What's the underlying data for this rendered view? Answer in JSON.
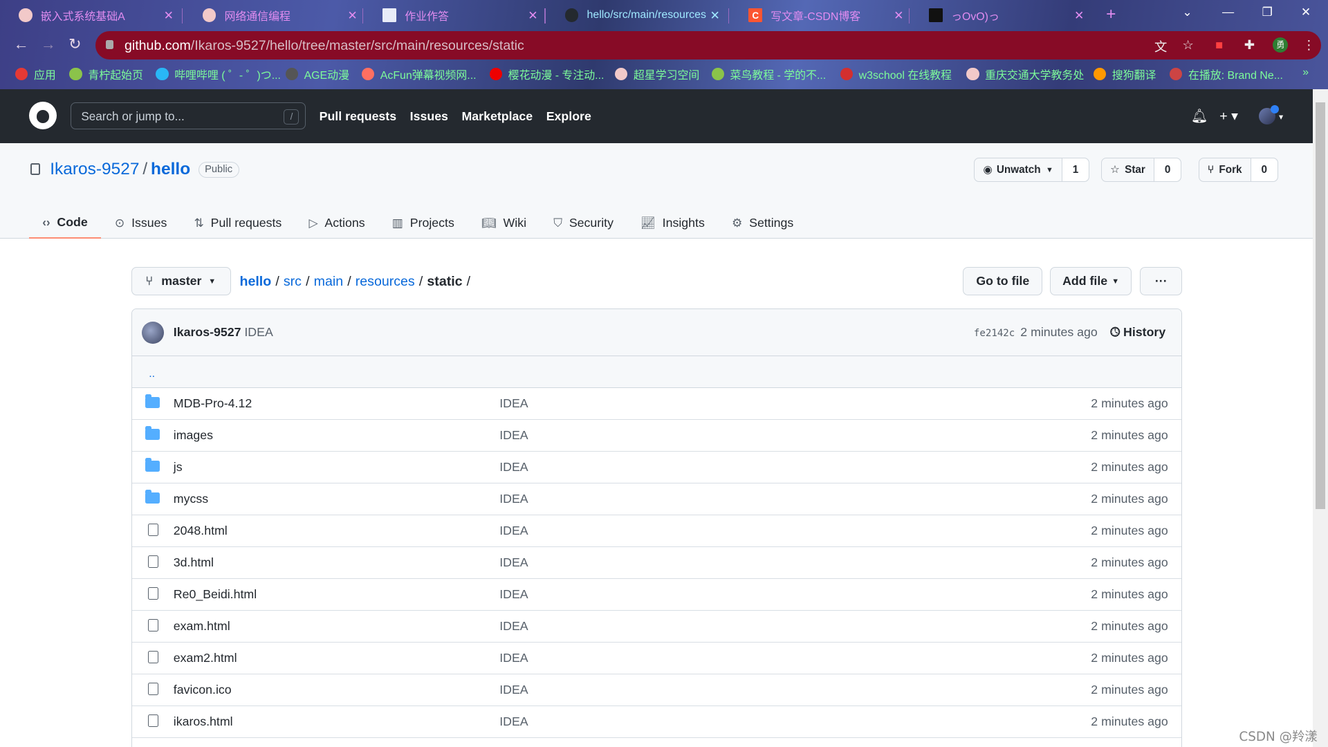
{
  "browser": {
    "tabs": [
      {
        "title": "嵌入式系统基础A",
        "active": false
      },
      {
        "title": "网络通信编程",
        "active": false
      },
      {
        "title": "作业作答",
        "active": false
      },
      {
        "title": "hello/src/main/resources",
        "active": true
      },
      {
        "title": "写文章-CSDN博客",
        "active": false
      },
      {
        "title": "っOvO)っ",
        "active": false
      }
    ],
    "url_host": "github.com",
    "url_path": "/Ikaros-9527/hello/tree/master/src/main/resources/static",
    "bookmarks": [
      "应用",
      "青柠起始页",
      "哔哩哔哩 ( ゜- ゜)つ...",
      "AGE动漫",
      "AcFun弹幕视频网...",
      "樱花动漫 - 专注动...",
      "超星学习空间",
      "菜鸟教程 - 学的不...",
      "w3school 在线教程",
      "重庆交通大学教务处",
      "搜狗翻译",
      "在播放: Brand Ne..."
    ],
    "accent": "#870b26"
  },
  "header": {
    "search_placeholder": "Search or jump to...",
    "slash": "/",
    "nav": [
      "Pull requests",
      "Issues",
      "Marketplace",
      "Explore"
    ]
  },
  "repo": {
    "owner": "Ikaros-9527",
    "name": "hello",
    "visibility": "Public",
    "watch_label": "Unwatch",
    "watch_count": "1",
    "star_label": "Star",
    "star_count": "0",
    "fork_label": "Fork",
    "fork_count": "0",
    "tabs": [
      "Code",
      "Issues",
      "Pull requests",
      "Actions",
      "Projects",
      "Wiki",
      "Security",
      "Insights",
      "Settings"
    ],
    "selected_tab": "Code"
  },
  "browser_path": {
    "branch": "master",
    "crumbs": [
      "hello",
      "src",
      "main",
      "resources"
    ],
    "current": "static",
    "go_to_file": "Go to file",
    "add_file": "Add file",
    "more": "···"
  },
  "commit": {
    "author": "Ikaros-9527",
    "message": "IDEA",
    "sha": "fe2142c",
    "time": "2 minutes ago",
    "history": "History"
  },
  "parent_dir": "..",
  "files": [
    {
      "name": "MDB-Pro-4.12",
      "type": "folder",
      "message": "IDEA",
      "time": "2 minutes ago"
    },
    {
      "name": "images",
      "type": "folder",
      "message": "IDEA",
      "time": "2 minutes ago"
    },
    {
      "name": "js",
      "type": "folder",
      "message": "IDEA",
      "time": "2 minutes ago"
    },
    {
      "name": "mycss",
      "type": "folder",
      "message": "IDEA",
      "time": "2 minutes ago"
    },
    {
      "name": "2048.html",
      "type": "file",
      "message": "IDEA",
      "time": "2 minutes ago"
    },
    {
      "name": "3d.html",
      "type": "file",
      "message": "IDEA",
      "time": "2 minutes ago"
    },
    {
      "name": "Re0_Beidi.html",
      "type": "file",
      "message": "IDEA",
      "time": "2 minutes ago"
    },
    {
      "name": "exam.html",
      "type": "file",
      "message": "IDEA",
      "time": "2 minutes ago"
    },
    {
      "name": "exam2.html",
      "type": "file",
      "message": "IDEA",
      "time": "2 minutes ago"
    },
    {
      "name": "favicon.ico",
      "type": "file",
      "message": "IDEA",
      "time": "2 minutes ago"
    },
    {
      "name": "ikaros.html",
      "type": "file",
      "message": "IDEA",
      "time": "2 minutes ago"
    }
  ],
  "watermark": "CSDN @羚漾"
}
